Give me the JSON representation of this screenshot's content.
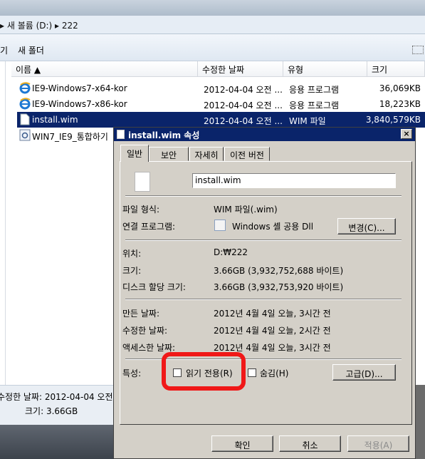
{
  "explorer": {
    "breadcrumb": "▸ 새 볼륨 (D:) ▸ 222",
    "toolbar": {
      "partial_left": "기",
      "new_folder": "새 폴더"
    },
    "columns": {
      "name": "이름 ▲",
      "date": "수정한 날짜",
      "type": "유형",
      "size": "크기"
    },
    "files": [
      {
        "name": "IE9-Windows7-x64-kor",
        "date": "2012-04-04 오전 ...",
        "type": "응용 프로그램",
        "size": "36,069KB",
        "icon": "ie-icon"
      },
      {
        "name": "IE9-Windows7-x86-kor",
        "date": "2012-04-04 오전 ...",
        "type": "응용 프로그램",
        "size": "18,223KB",
        "icon": "ie-icon"
      },
      {
        "name": "install.wim",
        "date": "2012-04-04 오전 ...",
        "type": "WIM 파일",
        "size": "3,840,579KB",
        "icon": "file-icon"
      },
      {
        "name": "WIN7_IE9_통합하기",
        "icon": "script-icon"
      }
    ],
    "details": {
      "modified": "수정한 날짜: 2012-04-04 오전",
      "size": "크기: 3.66GB"
    }
  },
  "dialog": {
    "title": "install.wim 속성",
    "close": "×",
    "tabs": [
      "일반",
      "보안",
      "자세히",
      "이전 버전"
    ],
    "filename": "install.wim",
    "props": {
      "type_label": "파일 형식:",
      "type_value": "WIM 파일(.wim)",
      "opens_label": "연결 프로그램:",
      "opens_value": "Windows 셸 공용 Dll",
      "change_button": "변경(C)...",
      "location_label": "위치:",
      "location_value": "D:₩222",
      "size_label": "크기:",
      "size_value": "3.66GB (3,932,752,688 바이트)",
      "disk_label": "디스크 할당 크기:",
      "disk_value": "3.66GB (3,932,753,920 바이트)",
      "created_label": "만든 날짜:",
      "created_value": "2012년 4월 4일 오늘, 3시간 전",
      "modified_label": "수정한 날짜:",
      "modified_value": "2012년 4월 4일 오늘, 2시간 전",
      "accessed_label": "액세스한 날짜:",
      "accessed_value": "2012년 4월 4일 오늘, 3시간 전",
      "attr_label": "특성:",
      "readonly": "읽기 전용(R)",
      "hidden": "숨김(H)",
      "advanced": "고급(D)..."
    },
    "buttons": {
      "ok": "확인",
      "cancel": "취소",
      "apply": "적용(A)"
    },
    "highlight_color": "#f01818",
    "selection_color": "#0a246a"
  }
}
